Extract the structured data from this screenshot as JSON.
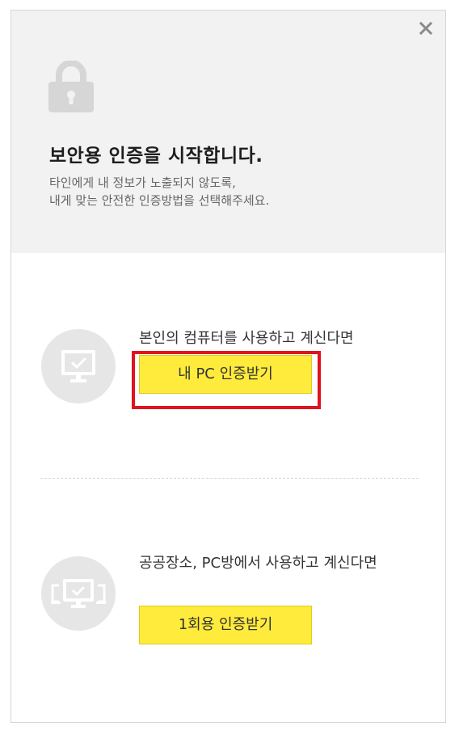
{
  "dialog": {
    "close_icon": "close-icon",
    "lock_icon": "lock-icon",
    "title": "보안용 인증을 시작합니다.",
    "description_lines": [
      "타인에게 내 정보가 노출되지 않도록,",
      "내게 맞는 안전한 인증방법을 선택해주세요."
    ]
  },
  "options": [
    {
      "icon": "monitor-check-icon",
      "text": "본인의 컴퓨터를 사용하고 계신다면",
      "button_label": "내 PC 인증받기"
    },
    {
      "icon": "public-monitor-check-icon",
      "text": "공공장소, PC방에서 사용하고 계신다면",
      "button_label": "1회용 인증받기"
    }
  ],
  "colors": {
    "button_bg": "#ffeb3b",
    "highlight_border": "#e0141e",
    "header_bg": "#f2f2f2",
    "icon_circle": "#e6e6e6"
  }
}
